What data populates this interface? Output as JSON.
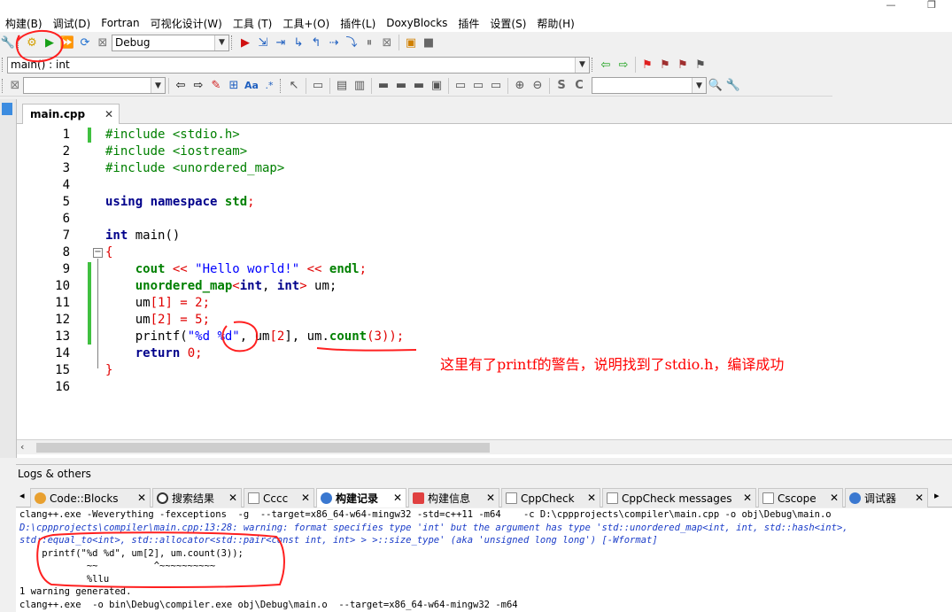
{
  "menu": {
    "items": [
      "构建(B)",
      "调试(D)",
      "Fortran",
      "可视化设计(W)",
      "工具 (T)",
      "工具+(O)",
      "插件(L)",
      "DoxyBlocks",
      "插件",
      "设置(S)",
      "帮助(H)"
    ]
  },
  "toolbar": {
    "build_target": "Debug",
    "scope": "main() : int",
    "search_value": ""
  },
  "editor": {
    "tab_label": "main.cpp",
    "tab_close": "✕",
    "line_numbers": [
      "1",
      "2",
      "3",
      "4",
      "5",
      "6",
      "7",
      "8",
      "9",
      "10",
      "11",
      "12",
      "13",
      "14",
      "15",
      "16"
    ],
    "code": {
      "l1": "#include <stdio.h>",
      "l2": "#include <iostream>",
      "l3": "#include <unordered_map>",
      "l5_kw": "using namespace",
      "l5_id": "std",
      "l5_end": ";",
      "l7_kw": "int",
      "l7_rest": " main()",
      "l8": "{",
      "l9_a": "cout",
      "l9_b": " << ",
      "l9_str": "\"Hello world!\"",
      "l9_c": " << ",
      "l9_d": "endl",
      "l9_e": ";",
      "l10_a": "unordered_map",
      "l10_b": "<",
      "l10_c": "int",
      "l10_d": ", ",
      "l10_e": "int",
      "l10_f": ">",
      "l10_g": " um;",
      "l11_a": "um",
      "l11_b": "[",
      "l11_c": "1",
      "l11_d": "] = ",
      "l11_e": "2",
      "l11_f": ";",
      "l12_a": "um",
      "l12_b": "[",
      "l12_c": "2",
      "l12_d": "] = ",
      "l12_e": "5",
      "l12_f": ";",
      "l13_a": "printf(",
      "l13_str": "\"%d %d\"",
      "l13_b": ", um",
      "l13_c": "[",
      "l13_d": "2",
      "l13_e": "], um.",
      "l13_f": "count",
      "l13_g": "(",
      "l13_h": "3",
      "l13_i": "));",
      "l14_kw": "return",
      "l14_num": "0",
      "l14_end": ";",
      "l15": "}"
    },
    "annotation": "这里有了printf的警告，说明找到了stdio.h，编译成功"
  },
  "logs": {
    "title": "Logs & others",
    "tabs": [
      "Code::Blocks",
      "搜索结果",
      "Cccc",
      "构建记录",
      "构建信息",
      "CppCheck",
      "CppCheck messages",
      "Cscope",
      "调试器"
    ],
    "close": "✕",
    "lines": [
      "clang++.exe -Weverything -fexceptions  -g  --target=x86_64-w64-mingw32 -std=c++11 -m64    -c D:\\cppprojects\\compiler\\main.cpp -o obj\\Debug\\main.o",
      "D:\\cppprojects\\compiler\\main.cpp:13:28: warning: format specifies type 'int' but the argument has type 'std::unordered_map<int, int, std::hash<int>,",
      "std::equal_to<int>, std::allocator<std::pair<const int, int> > >::size_type' (aka 'unsigned long long') [-Wformat]",
      "    printf(\"%d %d\", um[2], um.count(3));",
      "            ~~          ^~~~~~~~~~~",
      "            %llu",
      "1 warning generated.",
      "clang++.exe  -o bin\\Debug\\compiler.exe obj\\Debug\\main.o  --target=x86_64-w64-mingw32 -m64"
    ]
  },
  "colors": {
    "annotation_red": "#ff0000",
    "change_bar_green": "#40c040",
    "warning_blue": "#1a3cc8"
  }
}
